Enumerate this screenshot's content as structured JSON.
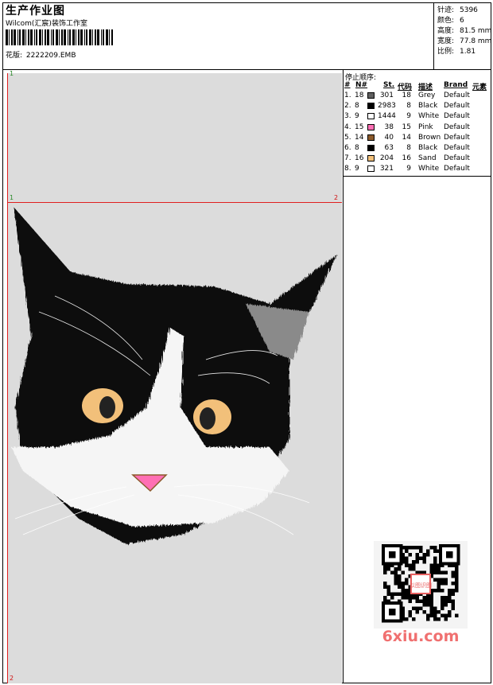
{
  "header": {
    "title": "生产作业图",
    "studio": "Wilcom(汇宸)装饰工作室",
    "file_label": "花版:",
    "file_name": "2222209.EMB"
  },
  "stats": [
    {
      "label": "针迹:",
      "value": "5396"
    },
    {
      "label": "颜色:",
      "value": "6"
    },
    {
      "label": "高度:",
      "value": "81.5 mm"
    },
    {
      "label": "宽度:",
      "value": "77.8 mm"
    },
    {
      "label": "比例:",
      "value": "1.81"
    }
  ],
  "stop_sequence": {
    "title": "停止顺序:",
    "headers": {
      "idx": "#",
      "n": "N#",
      "st": "St.",
      "code": "代码",
      "desc": "描述",
      "brand": "Brand",
      "element": "元素"
    },
    "rows": [
      {
        "idx": "1.",
        "n": "18",
        "color": "#606060",
        "st": "301",
        "code": "18",
        "desc": "Grey",
        "brand": "Default"
      },
      {
        "idx": "2.",
        "n": "8",
        "color": "#000000",
        "st": "2983",
        "code": "8",
        "desc": "Black",
        "brand": "Default"
      },
      {
        "idx": "3.",
        "n": "9",
        "color": "#ffffff",
        "st": "1444",
        "code": "9",
        "desc": "White",
        "brand": "Default"
      },
      {
        "idx": "4.",
        "n": "15",
        "color": "#ff6fb4",
        "st": "38",
        "code": "15",
        "desc": "Pink",
        "brand": "Default"
      },
      {
        "idx": "5.",
        "n": "14",
        "color": "#8b5a2b",
        "st": "40",
        "code": "14",
        "desc": "Brown",
        "brand": "Default"
      },
      {
        "idx": "6.",
        "n": "8",
        "color": "#000000",
        "st": "63",
        "code": "8",
        "desc": "Black",
        "brand": "Default"
      },
      {
        "idx": "7.",
        "n": "16",
        "color": "#f2c07a",
        "st": "204",
        "code": "16",
        "desc": "Sand",
        "brand": "Default"
      },
      {
        "idx": "8.",
        "n": "9",
        "color": "#ffffff",
        "st": "321",
        "code": "9",
        "desc": "White",
        "brand": "Default"
      }
    ]
  },
  "canvas": {
    "markers": {
      "top_left": "1",
      "mid_left": "1",
      "mid_right": "2",
      "bottom_left": "2"
    },
    "guide_color": "#e02020",
    "background": "#dcdcdc"
  },
  "watermark": {
    "text": "6xiu.com",
    "stamp_text": "以图识图"
  }
}
